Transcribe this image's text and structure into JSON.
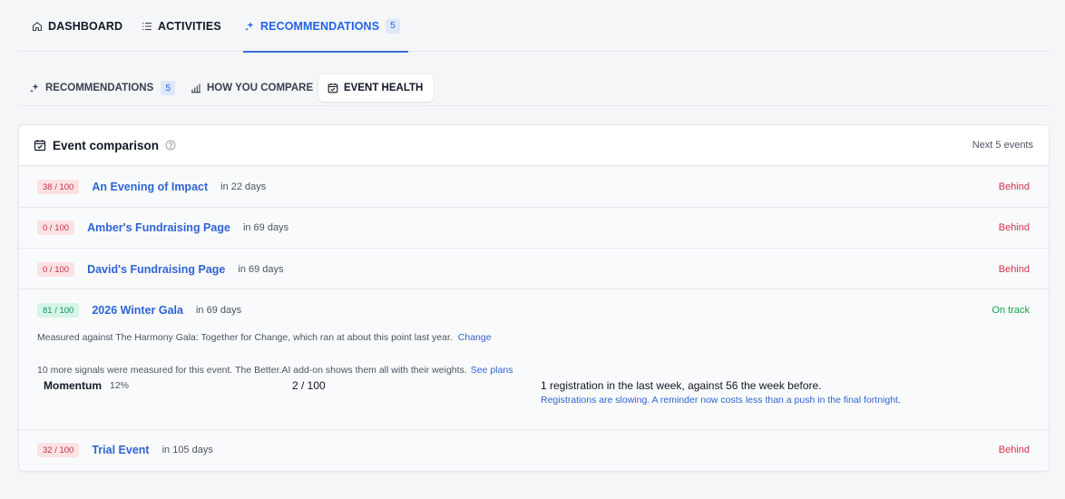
{
  "top_tabs": [
    {
      "label": "DASHBOARD",
      "icon": "home-icon"
    },
    {
      "label": "ACTIVITIES",
      "icon": "list-icon"
    },
    {
      "label": "RECOMMENDATIONS",
      "icon": "sparkle-icon",
      "count": "5",
      "active": true
    }
  ],
  "sub_tabs": [
    {
      "label": "RECOMMENDATIONS",
      "icon": "sparkle-icon",
      "count": "5"
    },
    {
      "label": "HOW YOU COMPARE",
      "icon": "bar-chart-icon"
    },
    {
      "label": "EVENT HEALTH",
      "icon": "calendar-check-icon",
      "active": true
    }
  ],
  "card": {
    "title": "Event comparison",
    "meta": "Next 5 events"
  },
  "events": [
    {
      "score": "38 / 100",
      "name": "An Evening of Impact",
      "when": "in 22 days",
      "status": "Behind"
    },
    {
      "score": "0 / 100",
      "name": "Amber's Fundraising Page",
      "when": "in 69 days",
      "status": "Behind"
    },
    {
      "score": "0 / 100",
      "name": "David's Fundraising Page",
      "when": "in 69 days",
      "status": "Behind"
    },
    {
      "score": "81 / 100",
      "name": "2026 Winter Gala",
      "when": "in 69 days",
      "status": "On track",
      "expanded": {
        "measured_text": "Measured against The Harmony Gala: Together for Change, which ran at about this point last year.",
        "change_link": "Change",
        "signals_text": "10 more signals were measured for this event. The Better.AI add-on shows them all with their weights.",
        "see_plans_link": "See plans",
        "metric": {
          "name": "Momentum",
          "weight": "12%",
          "score": "2 / 100",
          "note": "1 registration in the last week, against 56 the week before.",
          "sub": "Registrations are slowing. A reminder now costs less than a push in the final fortnight."
        }
      }
    },
    {
      "score": "32 / 100",
      "name": "Trial Event",
      "when": "in 105 days",
      "status": "Behind"
    }
  ],
  "colors": {
    "accent": "#2f64d6",
    "behind": "#d6324f",
    "on_track": "#16a34a"
  }
}
